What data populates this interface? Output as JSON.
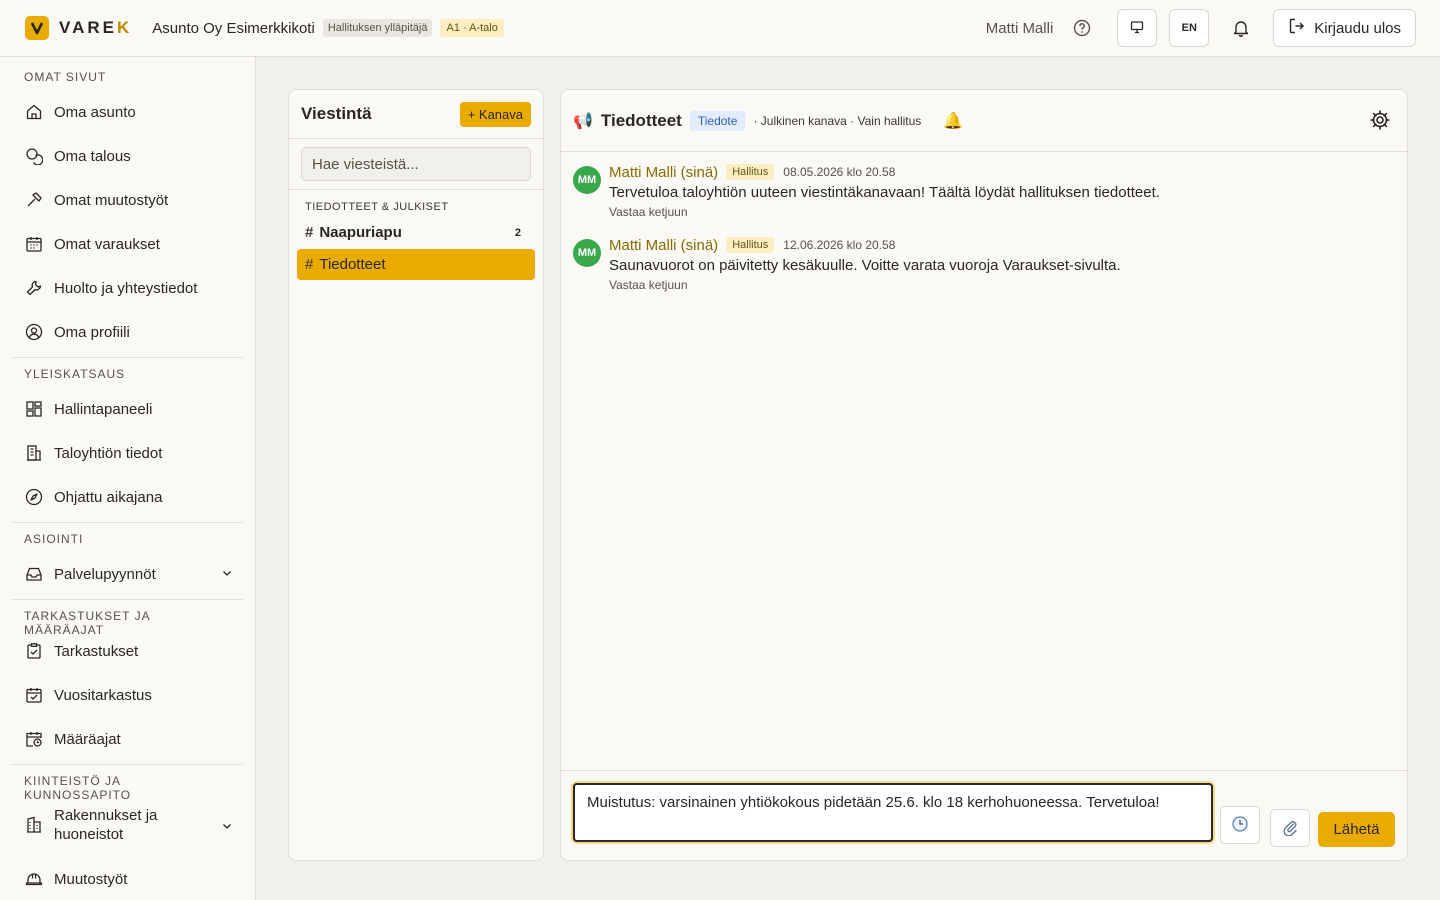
{
  "header": {
    "logo_text": "VAREK",
    "company": "Asunto Oy Esimerkkikoti",
    "role_badge": "Hallituksen ylläpitäjä",
    "unit_badge": "A1 · A-talo",
    "user_name": "Matti Malli",
    "language": "EN",
    "logout_label": "Kirjaudu ulos"
  },
  "sidebar": {
    "sections": [
      {
        "title": "OMAT SIVUT",
        "items": [
          {
            "label": "Oma asunto",
            "icon": "home-icon"
          },
          {
            "label": "Oma talous",
            "icon": "coins-icon"
          },
          {
            "label": "Omat muutostyöt",
            "icon": "hammer-icon"
          },
          {
            "label": "Omat varaukset",
            "icon": "calendar-icon"
          },
          {
            "label": "Huolto ja yhteystiedot",
            "icon": "wrench-icon"
          },
          {
            "label": "Oma profiili",
            "icon": "user-circle-icon"
          }
        ]
      },
      {
        "title": "YLEISKATSAUS",
        "items": [
          {
            "label": "Hallintapaneeli",
            "icon": "dashboard-icon"
          },
          {
            "label": "Taloyhtiön tiedot",
            "icon": "building-icon"
          },
          {
            "label": "Ohjattu aikajana",
            "icon": "compass-icon"
          }
        ]
      },
      {
        "title": "ASIOINTI",
        "items": [
          {
            "label": "Palvelupyynnöt",
            "icon": "inbox-icon"
          }
        ]
      },
      {
        "title": "TARKASTUKSET JA MÄÄRÄAJAT",
        "items": [
          {
            "label": "Tarkastukset",
            "icon": "clipboard-check-icon"
          },
          {
            "label": "Vuositarkastus",
            "icon": "calendar-check-icon"
          },
          {
            "label": "Määräajat",
            "icon": "calendar-clock-icon"
          }
        ]
      },
      {
        "title": "KIINTEISTÖ JA KUNNOSSAPITO",
        "items": [
          {
            "label": "Rakennukset ja huoneistot",
            "icon": "building-columns-icon"
          },
          {
            "label": "Muutostyöt",
            "icon": "hard-hat-icon"
          }
        ]
      }
    ]
  },
  "channels": {
    "title": "Viestintä",
    "add_label": "+ Kanava",
    "search_placeholder": "Hae viesteistä...",
    "group_title": "TIEDOTTEET & JULKISET",
    "items": [
      {
        "name": "Naapuriapu",
        "count": "2"
      },
      {
        "name": "Tiedotteet"
      }
    ]
  },
  "conversation": {
    "title": "Tiedotteet",
    "type_tag": "Tiedote",
    "meta": "· Julkinen kanava · Vain hallitus",
    "messages": [
      {
        "initials": "MM",
        "author": "Matti Malli (sinä)",
        "role": "Hallitus",
        "time": "08.05.2026 klo 20.58",
        "text": "Tervetuloa taloyhtiön uuteen viestintäkanavaan! Täältä löydät hallituksen tiedotteet.",
        "reply": "Vastaa ketjuun"
      },
      {
        "initials": "MM",
        "author": "Matti Malli (sinä)",
        "role": "Hallitus",
        "time": "12.06.2026 klo 20.58",
        "text": "Saunavuorot on päivitetty kesäkuulle. Voitte varata vuoroja Varaukset-sivulta.",
        "reply": "Vastaa ketjuun"
      }
    ],
    "draft": "Muistutus: varsinainen yhtiökokous pidetään 25.6. klo 18 kerhohuoneessa. Tervetuloa!",
    "send_label": "Lähetä"
  },
  "colors": {
    "accent": "#eaab00",
    "avatar": "#38a84a",
    "author": "#8a6a00",
    "tag_blue": "#2f5fb5"
  }
}
